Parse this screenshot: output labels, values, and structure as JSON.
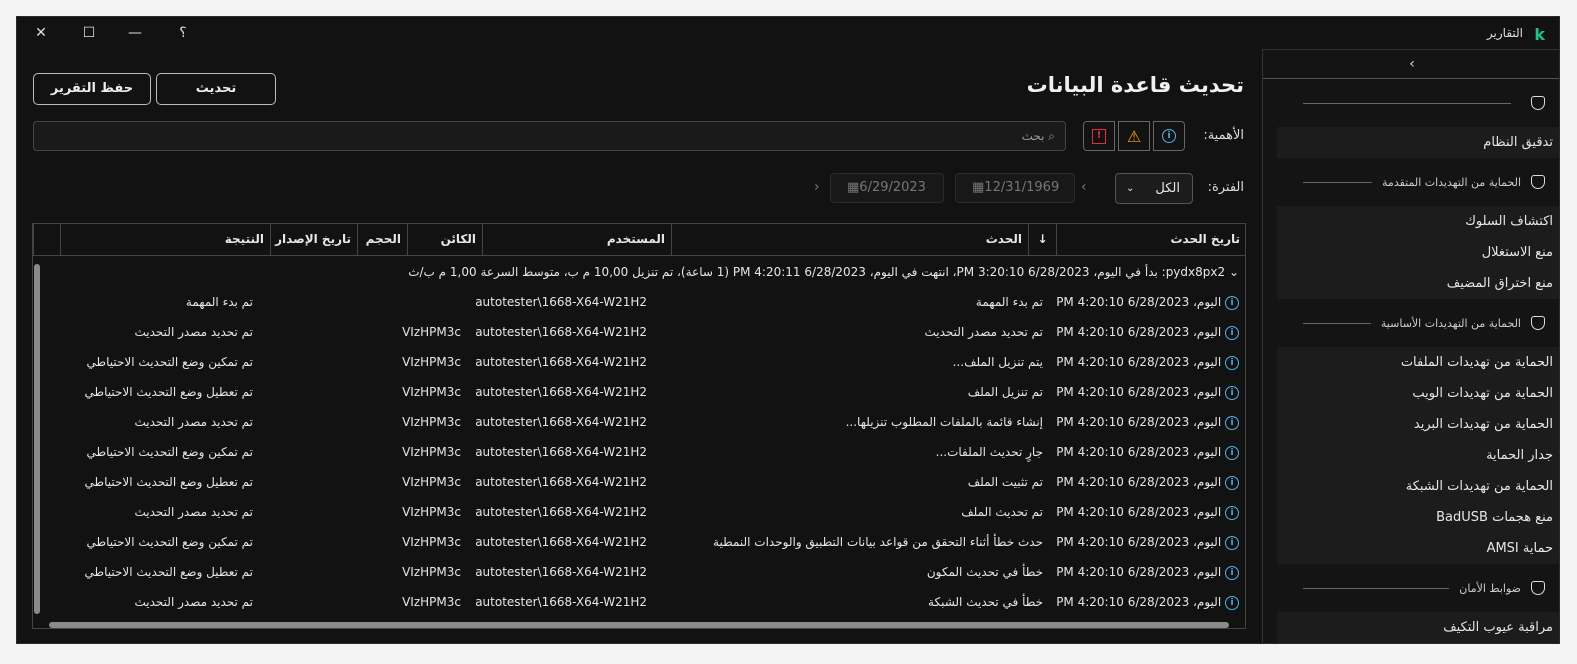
{
  "window": {
    "title": "التقارير",
    "logo": "k",
    "help": "؟",
    "minimize": "—",
    "maximize": "☐",
    "close": "✕"
  },
  "header": {
    "title": "تحديث قاعدة البيانات",
    "update_button": "تحديث",
    "save_button": "حفظ التقرير"
  },
  "filters": {
    "severity_label": "الأهمية:",
    "search_placeholder": "بحث",
    "period_label": "الفترة:",
    "period_value": "الكل",
    "date_from": "12/31/1969",
    "date_to": "6/29/2023"
  },
  "sidebar": {
    "collapse": "‹",
    "sections": [
      {
        "title": "",
        "items": [
          "تدقيق النظام"
        ]
      },
      {
        "title": "الحماية من التهديدات المتقدمة",
        "items": [
          "اكتشاف السلوك",
          "منع الاستغلال",
          "منع اختراق المضيف"
        ]
      },
      {
        "title": "الحماية من التهديدات الأساسية",
        "items": [
          "الحماية من تهديدات الملفات",
          "الحماية من تهديدات الويب",
          "الحماية من تهديدات البريد",
          "جدار الحماية",
          "الحماية من تهديدات الشبكة",
          "منع هجمات BadUSB",
          "حماية AMSI"
        ]
      },
      {
        "title": "ضوابط الأمان",
        "items": [
          "مراقبة عيوب التكيف"
        ]
      }
    ]
  },
  "table": {
    "columns": [
      "تاريخ الحدث",
      "الحدث",
      "المستخدم",
      "الكائن",
      "الحجم",
      "تاريخ الإصدار",
      "النتيجة"
    ],
    "sort_icon": "↓",
    "group": "pydx8px2: بدأ في اليوم، 6/28/2023 3:20:10 PM، انتهت في اليوم، 6/28/2023 4:20:11 PM (1 ساعة)، تم تنزيل 10,00 م ب، متوسط السرعة 1,00 م ب/ث",
    "rows": [
      {
        "date": "اليوم، 6/28/2023 4:20:10 PM",
        "event": "تم بدء المهمة",
        "user": "autotester\\1668-X64-W21H2",
        "object": "",
        "result": "تم بدء المهمة"
      },
      {
        "date": "اليوم، 6/28/2023 4:20:10 PM",
        "event": "تم تحديد مصدر التحديث",
        "user": "autotester\\1668-X64-W21H2",
        "object": "VIzHPM3c",
        "result": "تم تحديد مصدر التحديث"
      },
      {
        "date": "اليوم، 6/28/2023 4:20:10 PM",
        "event": "يتم تنزيل الملف...",
        "user": "autotester\\1668-X64-W21H2",
        "object": "VIzHPM3c",
        "result": "تم تمكين وضع التحديث الاحتياطي"
      },
      {
        "date": "اليوم، 6/28/2023 4:20:10 PM",
        "event": "تم تنزيل الملف",
        "user": "autotester\\1668-X64-W21H2",
        "object": "VIzHPM3c",
        "result": "تم تعطيل وضع التحديث الاحتياطي"
      },
      {
        "date": "اليوم، 6/28/2023 4:20:10 PM",
        "event": "إنشاء قائمة بالملفات المطلوب تنزيلها...",
        "user": "autotester\\1668-X64-W21H2",
        "object": "VIzHPM3c",
        "result": "تم تحديد مصدر التحديث"
      },
      {
        "date": "اليوم، 6/28/2023 4:20:10 PM",
        "event": "جارٍ تحديث الملفات...",
        "user": "autotester\\1668-X64-W21H2",
        "object": "VIzHPM3c",
        "result": "تم تمكين وضع التحديث الاحتياطي"
      },
      {
        "date": "اليوم، 6/28/2023 4:20:10 PM",
        "event": "تم تثبيت الملف",
        "user": "autotester\\1668-X64-W21H2",
        "object": "VIzHPM3c",
        "result": "تم تعطيل وضع التحديث الاحتياطي"
      },
      {
        "date": "اليوم، 6/28/2023 4:20:10 PM",
        "event": "تم تحديث الملف",
        "user": "autotester\\1668-X64-W21H2",
        "object": "VIzHPM3c",
        "result": "تم تحديد مصدر التحديث"
      },
      {
        "date": "اليوم، 6/28/2023 4:20:10 PM",
        "event": "حدث خطأ أثناء التحقق من قواعد بيانات التطبيق والوحدات النمطية",
        "user": "autotester\\1668-X64-W21H2",
        "object": "VIzHPM3c",
        "result": "تم تمكين وضع التحديث الاحتياطي"
      },
      {
        "date": "اليوم، 6/28/2023 4:20:10 PM",
        "event": "خطأ في تحديث المكون",
        "user": "autotester\\1668-X64-W21H2",
        "object": "VIzHPM3c",
        "result": "تم تعطيل وضع التحديث الاحتياطي"
      },
      {
        "date": "اليوم، 6/28/2023 4:20:10 PM",
        "event": "خطأ في تحديث الشبكة",
        "user": "autotester\\1668-X64-W21H2",
        "object": "VIzHPM3c",
        "result": "تم تحديد مصدر التحديث"
      }
    ]
  },
  "colors": {
    "accent": "#1fbf8f",
    "info": "#4fb3e6",
    "warning": "#f0a800",
    "critical": "#e0303a"
  }
}
